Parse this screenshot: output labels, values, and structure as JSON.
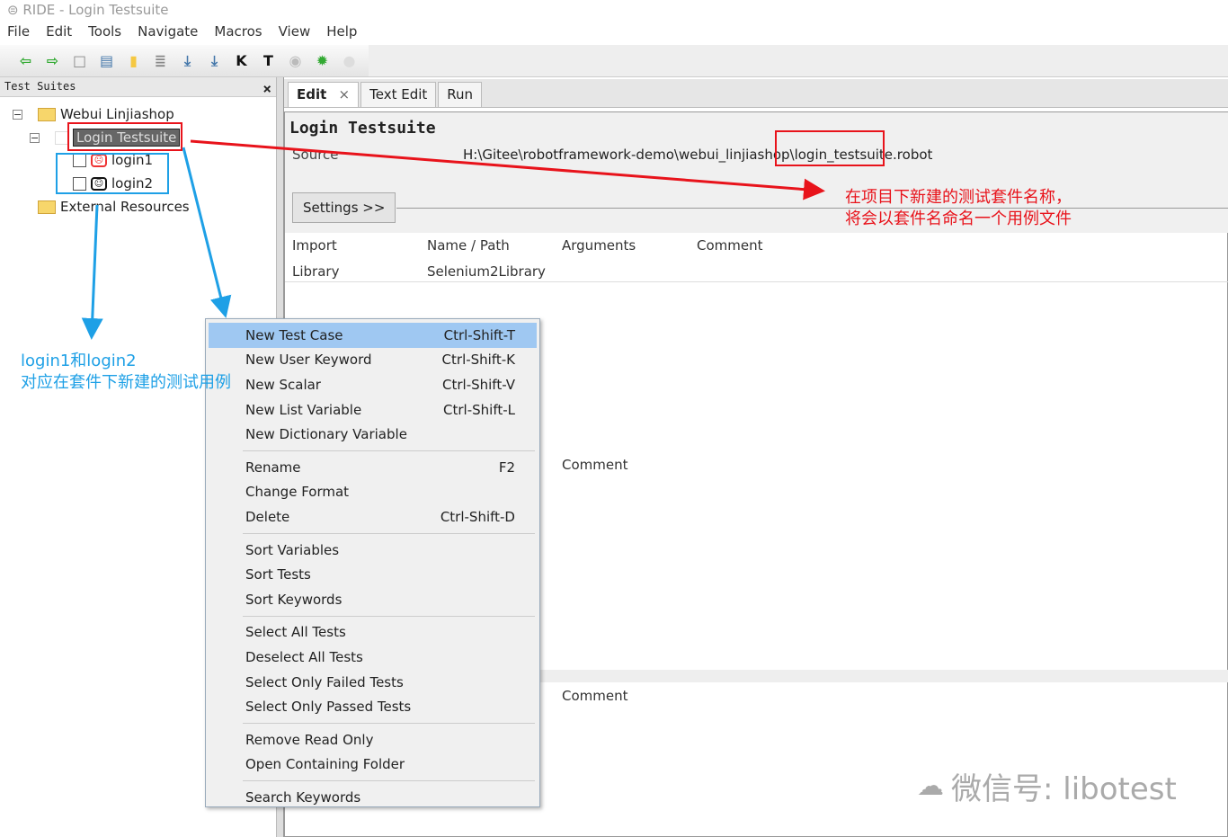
{
  "window": {
    "title": "RIDE - Login Testsuite"
  },
  "menubar": [
    "File",
    "Edit",
    "Tools",
    "Navigate",
    "Macros",
    "View",
    "Help"
  ],
  "toolbar": [
    "back-icon",
    "forward-icon",
    "new-project-icon",
    "open-icon",
    "open-folder-icon",
    "document-icon",
    "save-icon",
    "save-all-icon",
    "search-keyword-icon",
    "search-test-icon",
    "run-icon",
    "bug-icon",
    "stop-icon"
  ],
  "left_panel": {
    "title": "Test Suites",
    "close": "×",
    "tree": {
      "root": "Webui Linjiashop",
      "suite": "Login Testsuite",
      "tests": [
        "login1",
        "login2"
      ],
      "resources": "External Resources"
    }
  },
  "tabs": [
    "Edit",
    "Text Edit",
    "Run"
  ],
  "tab_close": "×",
  "editor": {
    "title": "Login Testsuite",
    "source_label": "Source",
    "source_value": "H:\\Gitee\\robotframework-demo\\webui_linjiashop\\login_testsuite.robot",
    "settings_button": "Settings >>",
    "import_table": {
      "headers": [
        "Import",
        "Name / Path",
        "Arguments",
        "Comment"
      ],
      "rows": [
        [
          "Library",
          "Selenium2Library"
        ]
      ]
    },
    "comment_headers": [
      "Comment",
      "Comment"
    ]
  },
  "context_menu": {
    "groups": [
      [
        {
          "label": "New Test Case",
          "shortcut": "Ctrl-Shift-T"
        },
        {
          "label": "New User Keyword",
          "shortcut": "Ctrl-Shift-K"
        },
        {
          "label": "New Scalar",
          "shortcut": "Ctrl-Shift-V"
        },
        {
          "label": "New List Variable",
          "shortcut": "Ctrl-Shift-L"
        },
        {
          "label": "New Dictionary Variable",
          "shortcut": ""
        }
      ],
      [
        {
          "label": "Rename",
          "shortcut": "F2"
        },
        {
          "label": "Change Format",
          "shortcut": ""
        },
        {
          "label": "Delete",
          "shortcut": "Ctrl-Shift-D"
        }
      ],
      [
        {
          "label": "Sort Variables",
          "shortcut": ""
        },
        {
          "label": "Sort Tests",
          "shortcut": ""
        },
        {
          "label": "Sort Keywords",
          "shortcut": ""
        }
      ],
      [
        {
          "label": "Select All Tests",
          "shortcut": ""
        },
        {
          "label": "Deselect All Tests",
          "shortcut": ""
        },
        {
          "label": "Select Only Failed Tests",
          "shortcut": ""
        },
        {
          "label": "Select Only Passed Tests",
          "shortcut": ""
        }
      ],
      [
        {
          "label": "Remove Read Only",
          "shortcut": ""
        },
        {
          "label": "Open Containing Folder",
          "shortcut": ""
        }
      ],
      [
        {
          "label": "Search Keywords",
          "shortcut": ""
        }
      ]
    ],
    "highlighted": "New Test Case"
  },
  "annotations": {
    "red": [
      "在项目下新建的测试套件名称，",
      "将会以套件名命名一个用例文件"
    ],
    "blue": [
      "login1和login2",
      "对应在套件下新建的测试用例"
    ]
  },
  "watermark": "微信号: libotest",
  "colors": {
    "annotation_red": "#e8131b",
    "annotation_blue": "#1ea0e6",
    "menu_highlight": "#9fc8f2"
  }
}
